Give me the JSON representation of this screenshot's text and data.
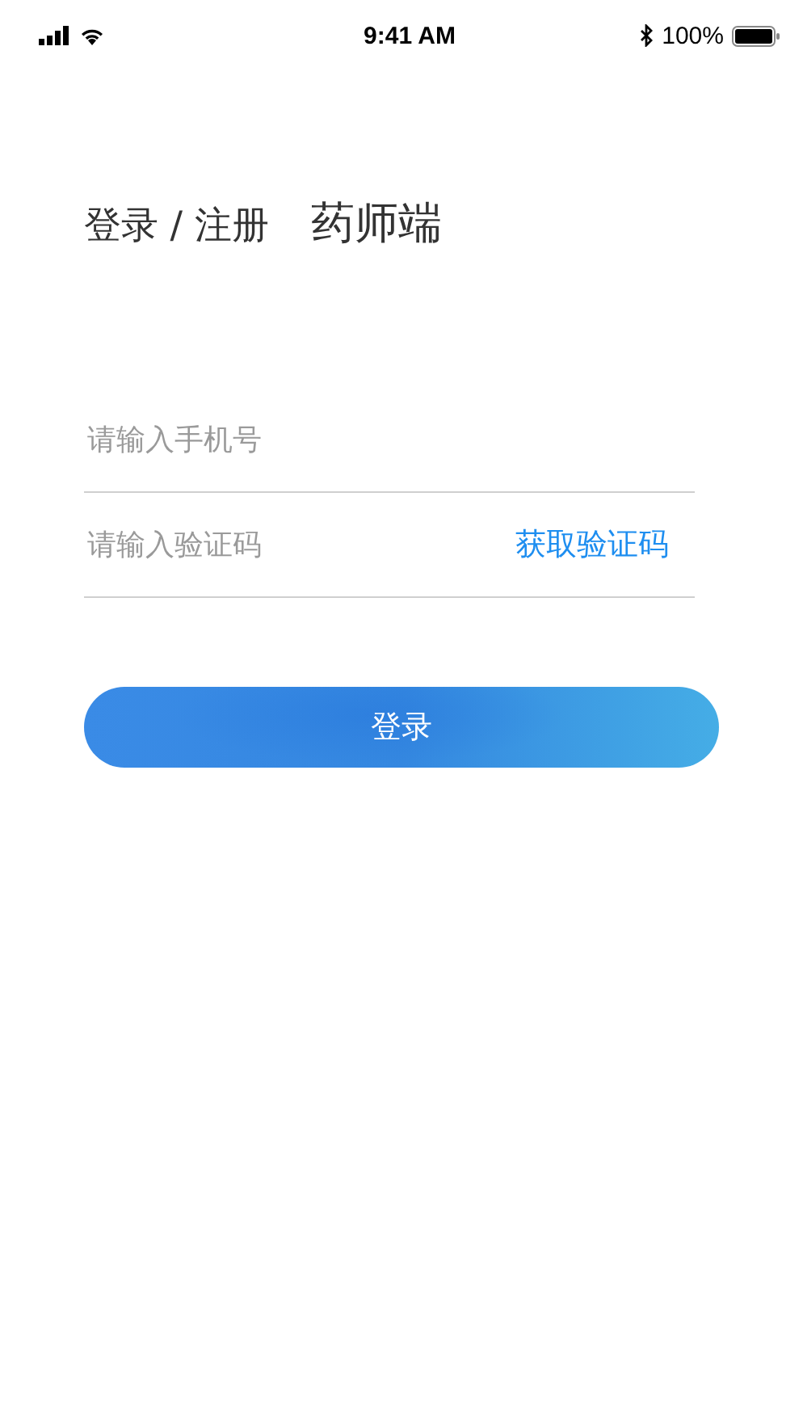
{
  "status_bar": {
    "time": "9:41 AM",
    "battery": "100%"
  },
  "title": {
    "heading": "登录 / 注册",
    "role": "药师端"
  },
  "phone_field": {
    "placeholder": "请输入手机号"
  },
  "code_field": {
    "placeholder": "请输入验证码",
    "action": "获取验证码"
  },
  "login_button": "登录"
}
